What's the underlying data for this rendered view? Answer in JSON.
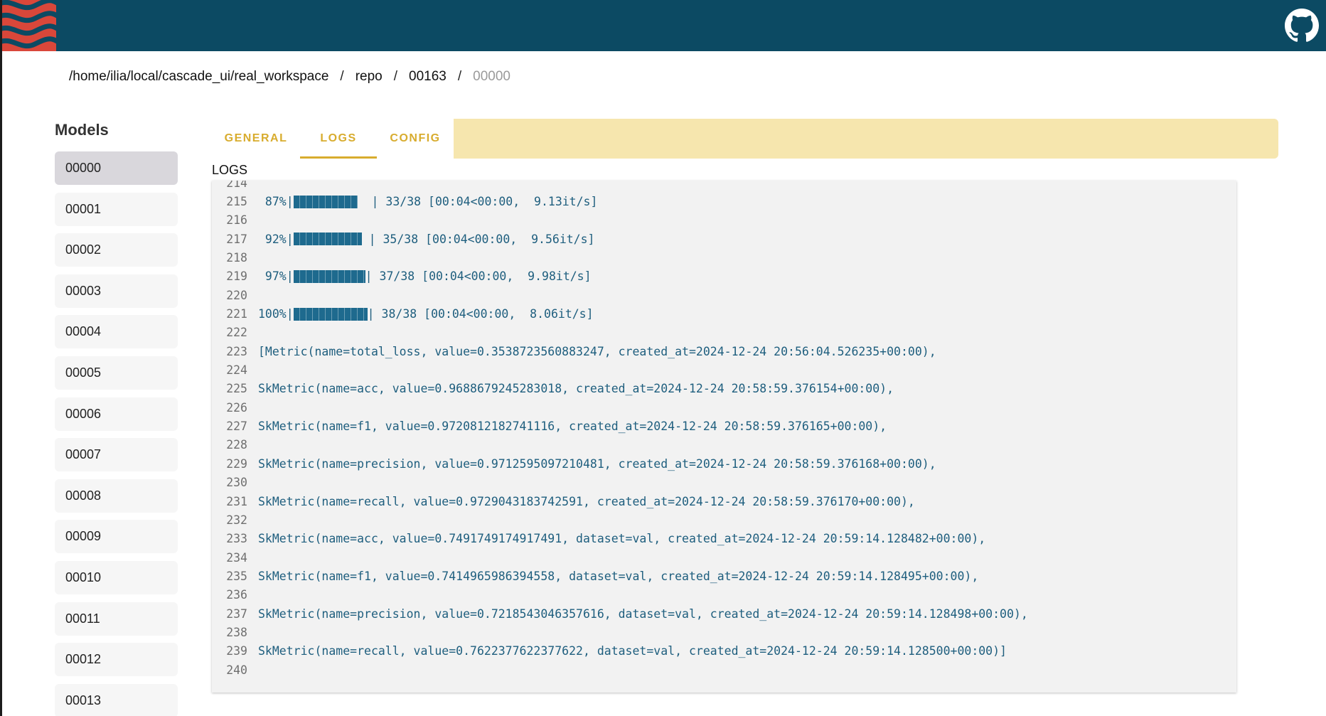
{
  "colors": {
    "topbar": "#0c4a63",
    "logo": "#d9473a",
    "tab_accent": "#d8ac2e",
    "tab_bar": "#f6e6ae",
    "log_text": "#1e5e7e",
    "progress_bar": "#1e6a8e"
  },
  "header": {
    "logo_icon": "cascade-logo",
    "github_icon": "github-icon"
  },
  "breadcrumb": {
    "segments": [
      "/home/ilia/local/cascade_ui/real_workspace",
      "repo",
      "00163"
    ],
    "current": "00000",
    "separator": "/"
  },
  "sidebar": {
    "title": "Models",
    "items": [
      "00000",
      "00001",
      "00002",
      "00003",
      "00004",
      "00005",
      "00006",
      "00007",
      "00008",
      "00009",
      "00010",
      "00011",
      "00012",
      "00013"
    ],
    "selected": "00000"
  },
  "tabs": [
    {
      "label": "GENERAL"
    },
    {
      "label": "LOGS"
    },
    {
      "label": "CONFIG"
    }
  ],
  "active_tab": "LOGS",
  "logs": {
    "label": "LOGS",
    "lines": [
      {
        "n": "214",
        "text": ""
      },
      {
        "n": "215",
        "pct": " 87%|",
        "bar": 0.87,
        "rest": "  | 33/38 [00:04<00:00,  9.13it/s]"
      },
      {
        "n": "216",
        "text": ""
      },
      {
        "n": "217",
        "pct": " 92%|",
        "bar": 0.92,
        "rest": " | 35/38 [00:04<00:00,  9.56it/s]"
      },
      {
        "n": "218",
        "text": ""
      },
      {
        "n": "219",
        "pct": " 97%|",
        "bar": 0.97,
        "rest": "| 37/38 [00:04<00:00,  9.98it/s]"
      },
      {
        "n": "220",
        "text": ""
      },
      {
        "n": "221",
        "pct": "100%|",
        "bar": 1.0,
        "rest": "| 38/38 [00:04<00:00,  8.06it/s]"
      },
      {
        "n": "222",
        "text": ""
      },
      {
        "n": "223",
        "text": "[Metric(name=total_loss, value=0.3538723560883247, created_at=2024-12-24 20:56:04.526235+00:00),"
      },
      {
        "n": "224",
        "text": ""
      },
      {
        "n": "225",
        "text": "SkMetric(name=acc, value=0.9688679245283018, created_at=2024-12-24 20:58:59.376154+00:00),"
      },
      {
        "n": "226",
        "text": ""
      },
      {
        "n": "227",
        "text": "SkMetric(name=f1, value=0.9720812182741116, created_at=2024-12-24 20:58:59.376165+00:00),"
      },
      {
        "n": "228",
        "text": ""
      },
      {
        "n": "229",
        "text": "SkMetric(name=precision, value=0.9712595097210481, created_at=2024-12-24 20:58:59.376168+00:00),"
      },
      {
        "n": "230",
        "text": ""
      },
      {
        "n": "231",
        "text": "SkMetric(name=recall, value=0.9729043183742591, created_at=2024-12-24 20:58:59.376170+00:00),"
      },
      {
        "n": "232",
        "text": ""
      },
      {
        "n": "233",
        "text": "SkMetric(name=acc, value=0.7491749174917491, dataset=val, created_at=2024-12-24 20:59:14.128482+00:00),"
      },
      {
        "n": "234",
        "text": ""
      },
      {
        "n": "235",
        "text": "SkMetric(name=f1, value=0.7414965986394558, dataset=val, created_at=2024-12-24 20:59:14.128495+00:00),"
      },
      {
        "n": "236",
        "text": ""
      },
      {
        "n": "237",
        "text": "SkMetric(name=precision, value=0.7218543046357616, dataset=val, created_at=2024-12-24 20:59:14.128498+00:00),"
      },
      {
        "n": "238",
        "text": ""
      },
      {
        "n": "239",
        "text": "SkMetric(name=recall, value=0.7622377622377622, dataset=val, created_at=2024-12-24 20:59:14.128500+00:00)]"
      },
      {
        "n": "240",
        "text": ""
      }
    ]
  }
}
